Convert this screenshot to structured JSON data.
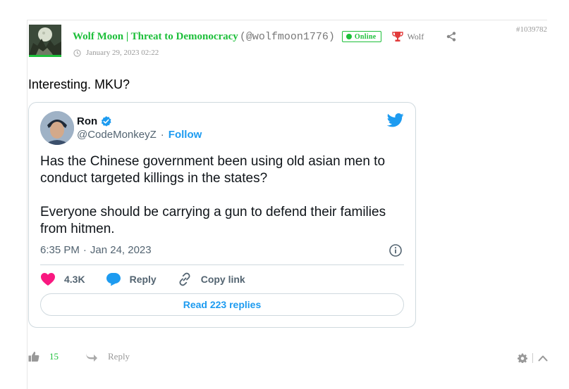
{
  "comment": {
    "id": "#1039782",
    "author_name": "Wolf Moon | Threat to Demonocracy",
    "author_handle": "(@wolfmoon1776)",
    "status": "Online",
    "rank": "Wolf",
    "date": "January 29, 2023 02:22",
    "text": "Interesting. MKU?",
    "votes": "15",
    "reply_label": "Reply",
    "colors": {
      "accent": "#1dbf3a",
      "muted": "#999999"
    }
  },
  "tweet": {
    "name": "Ron",
    "handle": "@CodeMonkeyZ",
    "separator": "·",
    "follow_label": "Follow",
    "body": [
      "Has the Chinese government been using old asian men to conduct targeted killings in the states?",
      "Everyone should be carrying a gun to defend their families from hitmen."
    ],
    "time": "6:35 PM",
    "date": "Jan 24, 2023",
    "likes": "4.3K",
    "reply_label": "Reply",
    "copy_link_label": "Copy link",
    "read_replies_label": "Read 223 replies",
    "colors": {
      "brand": "#1d9bf0",
      "heart": "#f91880",
      "text": "#0f1419",
      "muted": "#536471"
    }
  },
  "icons": [
    "trophy-icon",
    "share-icon",
    "clock-icon",
    "verified-icon",
    "twitter-icon",
    "info-icon",
    "heart-icon",
    "reply-bubble-icon",
    "link-icon",
    "thumbs-up-icon",
    "reply-arrow-icon",
    "gear-icon",
    "chevron-up-icon"
  ]
}
